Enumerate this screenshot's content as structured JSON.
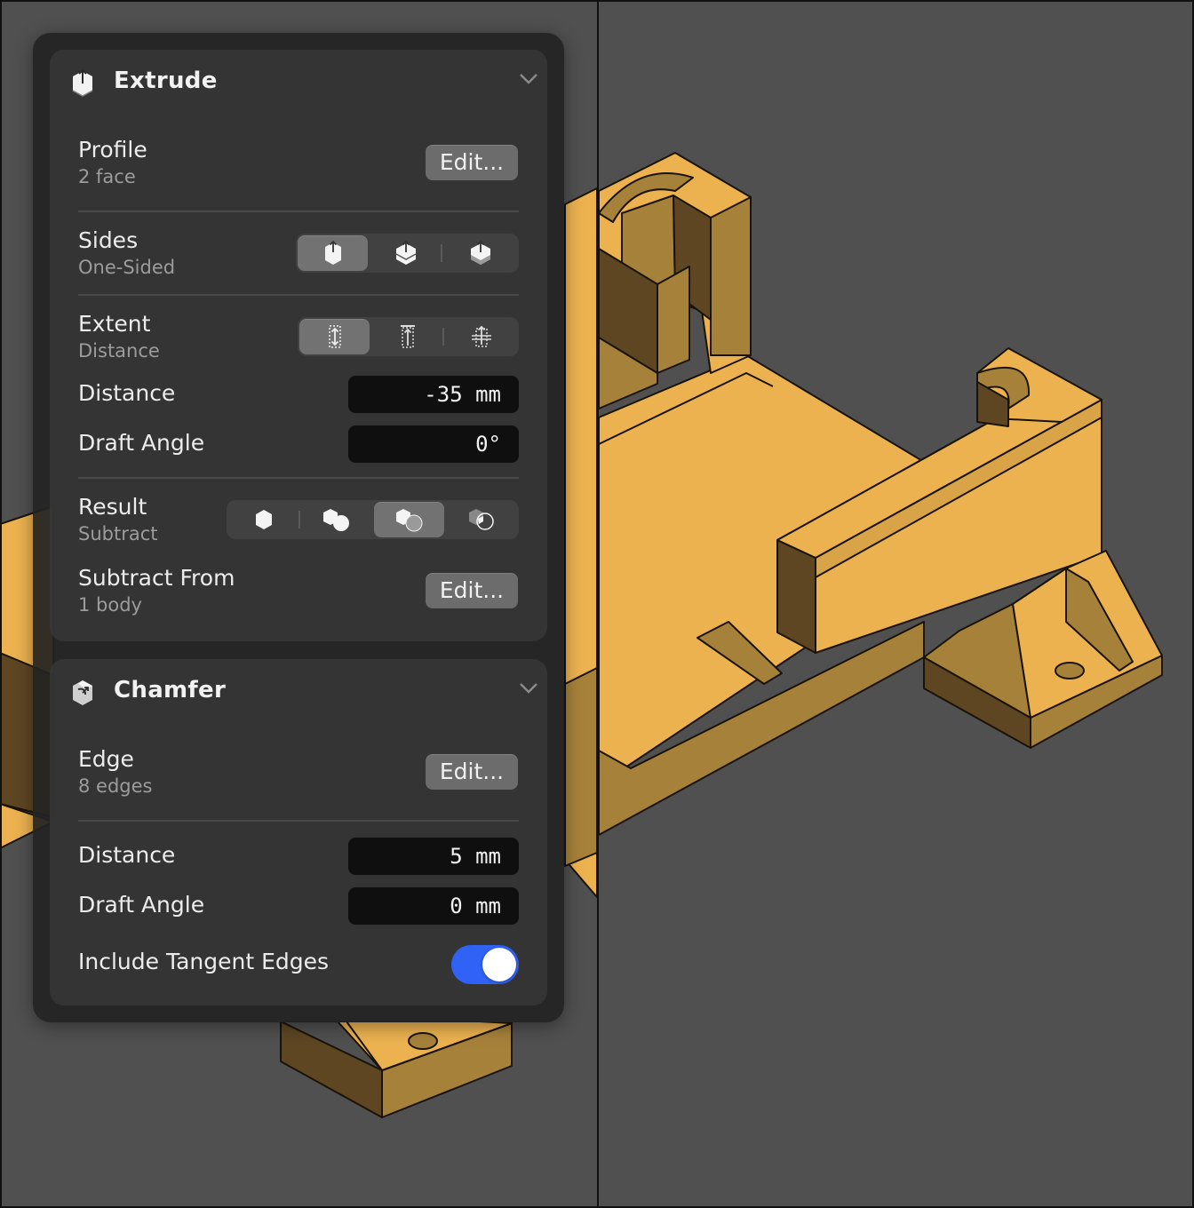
{
  "extrude": {
    "title": "Extrude",
    "icon": "extrude-icon",
    "profile": {
      "label": "Profile",
      "sub": "2 face",
      "button": "Edit..."
    },
    "sides": {
      "label": "Sides",
      "sub": "One-Sided",
      "options": [
        "one-sided-icon",
        "symmetric-icon",
        "two-sided-icon"
      ],
      "selected": 0
    },
    "extent": {
      "label": "Extent",
      "sub": "Distance",
      "options": [
        "distance-extent-icon",
        "to-object-extent-icon",
        "through-all-extent-icon"
      ],
      "selected": 0
    },
    "distance": {
      "label": "Distance",
      "value": "-35 mm"
    },
    "draft_angle": {
      "label": "Draft Angle",
      "value": "0°"
    },
    "result": {
      "label": "Result",
      "sub": "Subtract",
      "options": [
        "new-body-icon",
        "join-icon",
        "subtract-icon",
        "intersect-icon"
      ],
      "selected": 2
    },
    "subtract_from": {
      "label": "Subtract From",
      "sub": "1 body",
      "button": "Edit..."
    }
  },
  "chamfer": {
    "title": "Chamfer",
    "icon": "chamfer-icon",
    "edge": {
      "label": "Edge",
      "sub": "8 edges",
      "button": "Edit..."
    },
    "distance": {
      "label": "Distance",
      "value": "5 mm"
    },
    "draft_angle": {
      "label": "Draft Angle",
      "value": "0 mm"
    },
    "include_tangent": {
      "label": "Include Tangent Edges",
      "on": true
    }
  },
  "colors": {
    "accent": "#2f62f5",
    "model_top": "#ecb250",
    "model_side": "#a6813a",
    "model_dark": "#5e4623",
    "background": "#505050"
  }
}
